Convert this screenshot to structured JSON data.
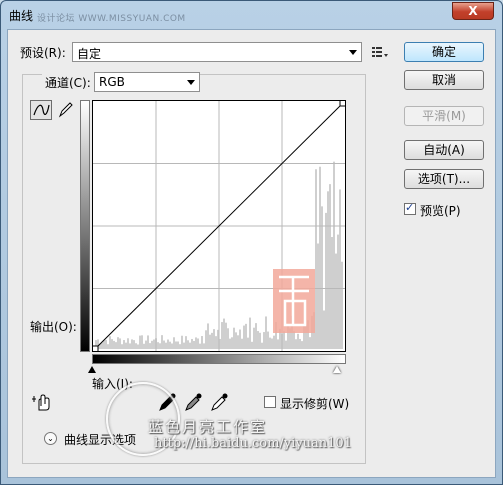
{
  "window": {
    "title": "曲线",
    "watermark_url": "设计论坛 WWW.MISSYUAN.COM",
    "close_label": "X"
  },
  "preset": {
    "label": "预设(R):",
    "value": "自定"
  },
  "channel": {
    "label": "通道(C):",
    "value": "RGB"
  },
  "buttons": {
    "ok": "确定",
    "cancel": "取消",
    "smooth": "平滑(M)",
    "auto": "自动(A)",
    "options": "选项(T)..."
  },
  "preview": {
    "label": "预览(P)",
    "checked": true
  },
  "graph": {
    "output_label": "输出(O):",
    "input_label": "输入(I):"
  },
  "show_clipping": {
    "label": "显示修剪(W)",
    "checked": false
  },
  "curve_display": {
    "label": "曲线显示选项"
  },
  "watermark": {
    "studio": "蓝色月亮工作室",
    "url": "http://hi.baidu.com/yiyuan101"
  },
  "chart_data": {
    "type": "line",
    "x": [
      0,
      255
    ],
    "y": [
      0,
      255
    ],
    "xlim": [
      0,
      255
    ],
    "ylim": [
      0,
      255
    ],
    "grid": true
  }
}
